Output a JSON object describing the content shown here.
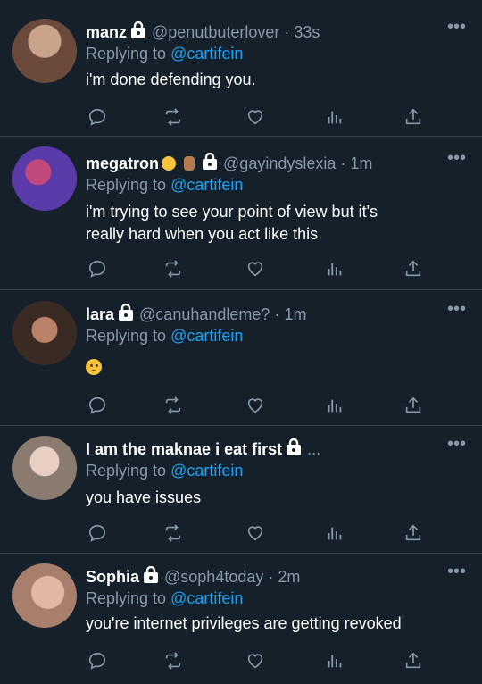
{
  "tweets": [
    {
      "name": "manz",
      "handle": "@penutbuterlover",
      "dot": "·",
      "time": "33s",
      "replying_prefix": "Replying to ",
      "replying_to": "@cartifein",
      "text": "i'm done defending you.",
      "avatar_color": "#6b4a3c"
    },
    {
      "name": "megatron",
      "handle": "@gayindyslexia",
      "dot": "·",
      "time": "1m",
      "replying_prefix": "Replying to ",
      "replying_to": "@cartifein",
      "text_line1": "i'm trying to see your point of view but it's",
      "text_line2": "really hard when you act like this",
      "avatar_color": "#5a3aa8"
    },
    {
      "name": "lara",
      "handle": "@canuhandleme?",
      "dot": "·",
      "time": "1m",
      "replying_prefix": "Replying to ",
      "replying_to": "@cartifein",
      "text": "",
      "avatar_color": "#3a2a24"
    },
    {
      "name": "I am the maknae i eat first",
      "handle": "",
      "dot": "",
      "time": "",
      "ellipsis": "...",
      "replying_prefix": "Replying to ",
      "replying_to": "@cartifein",
      "text": "you have issues",
      "avatar_color": "#8a7a70"
    },
    {
      "name": "Sophia",
      "handle": "@soph4today",
      "dot": "·",
      "time": "2m",
      "replying_prefix": "Replying to ",
      "replying_to": "@cartifein",
      "text": "you're internet privileges are getting revoked",
      "avatar_color": "#a87e6c"
    }
  ],
  "more_label": "•••",
  "colors": {
    "background": "#15202b",
    "secondary_text": "#8899a6",
    "link": "#1da1f2",
    "divider": "#38444d"
  }
}
